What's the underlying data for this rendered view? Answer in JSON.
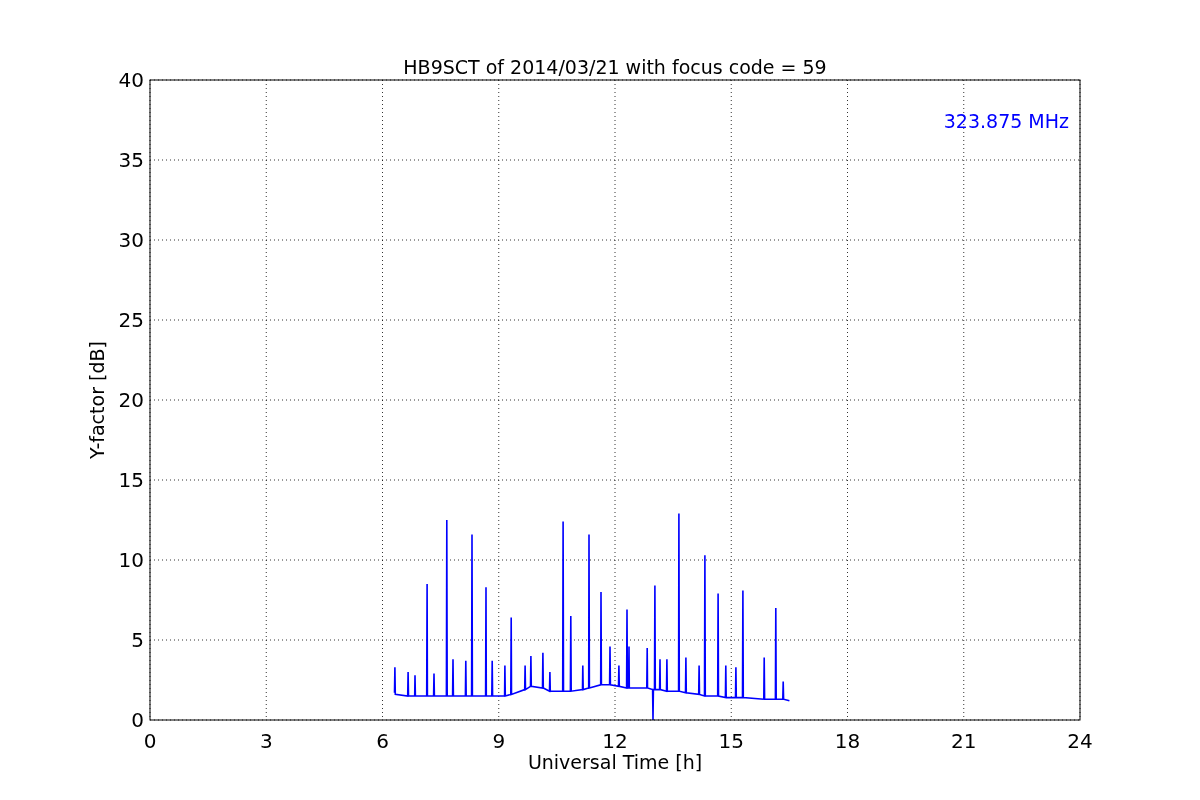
{
  "figure": {
    "chart_data": {
      "type": "line",
      "title": "HB9SCT of 2014/03/21 with focus code = 59",
      "xlabel": "Universal Time [h]",
      "ylabel": "Y-factor [dB]",
      "xlim": [
        0,
        24
      ],
      "ylim": [
        0,
        40
      ],
      "xticks": [
        0,
        3,
        6,
        9,
        12,
        15,
        18,
        21,
        24
      ],
      "yticks": [
        0,
        5,
        10,
        15,
        20,
        25,
        30,
        35,
        40
      ],
      "x": [
        6.31,
        6.32,
        6.33,
        6.65,
        6.66,
        6.67,
        6.83,
        6.84,
        6.85,
        7.14,
        7.15,
        7.16,
        7.32,
        7.33,
        7.34,
        7.65,
        7.66,
        7.67,
        7.81,
        7.82,
        7.83,
        8.14,
        8.15,
        8.16,
        8.3,
        8.31,
        8.32,
        8.66,
        8.67,
        8.68,
        8.82,
        8.83,
        8.84,
        9.15,
        9.16,
        9.17,
        9.31,
        9.32,
        9.33,
        9.67,
        9.68,
        9.69,
        9.82,
        9.83,
        9.84,
        10.13,
        10.14,
        10.15,
        10.31,
        10.32,
        10.33,
        10.65,
        10.66,
        10.67,
        10.85,
        10.86,
        10.87,
        11.16,
        11.17,
        11.18,
        11.32,
        11.33,
        11.34,
        11.63,
        11.64,
        11.65,
        11.86,
        11.87,
        11.88,
        12.09,
        12.1,
        12.11,
        12.3,
        12.31,
        12.32,
        12.35,
        12.36,
        12.37,
        12.82,
        12.83,
        12.84,
        12.97,
        12.98,
        12.99,
        13.02,
        13.03,
        13.04,
        13.15,
        13.16,
        13.17,
        13.33,
        13.34,
        13.35,
        13.64,
        13.65,
        13.66,
        13.82,
        13.83,
        13.84,
        14.16,
        14.17,
        14.18,
        14.31,
        14.32,
        14.33,
        14.65,
        14.66,
        14.67,
        14.85,
        14.86,
        14.87,
        15.11,
        15.12,
        15.13,
        15.29,
        15.3,
        15.31,
        15.84,
        15.85,
        15.86,
        16.14,
        16.15,
        16.16,
        16.33,
        16.34,
        16.35,
        16.5
      ],
      "series": [
        {
          "color": "#0000ff",
          "values": [
            1.7,
            3.3,
            1.6,
            1.5,
            3.0,
            1.5,
            1.5,
            2.8,
            1.5,
            1.5,
            8.5,
            1.5,
            1.5,
            2.9,
            1.5,
            1.5,
            12.5,
            1.5,
            1.5,
            3.8,
            1.5,
            1.5,
            3.7,
            1.5,
            1.5,
            11.6,
            1.5,
            1.5,
            8.3,
            1.5,
            1.5,
            3.7,
            1.5,
            1.5,
            3.4,
            1.5,
            1.6,
            6.4,
            1.6,
            1.9,
            3.4,
            1.9,
            2.1,
            4.0,
            2.1,
            2.0,
            4.2,
            2.0,
            1.8,
            3.0,
            1.8,
            1.8,
            12.4,
            1.8,
            1.8,
            6.5,
            1.8,
            1.9,
            3.4,
            1.9,
            2.0,
            11.6,
            2.0,
            2.2,
            8.0,
            2.2,
            2.2,
            4.6,
            2.2,
            2.1,
            3.4,
            2.1,
            2.0,
            6.9,
            2.0,
            2.0,
            4.6,
            2.0,
            2.0,
            4.5,
            2.0,
            1.9,
            0,
            1.9,
            1.9,
            8.4,
            1.9,
            1.9,
            3.8,
            1.9,
            1.8,
            3.8,
            1.8,
            1.8,
            12.9,
            1.8,
            1.7,
            3.9,
            1.7,
            1.6,
            3.4,
            1.6,
            1.5,
            10.3,
            1.5,
            1.5,
            7.9,
            1.5,
            1.4,
            3.4,
            1.4,
            1.4,
            3.3,
            1.4,
            1.4,
            8.1,
            1.4,
            1.3,
            3.9,
            1.3,
            1.3,
            7.0,
            1.3,
            1.3,
            2.4,
            1.3,
            1.2
          ]
        }
      ],
      "annotations": [
        {
          "text": "323.875 MHz"
        }
      ],
      "grid": true
    }
  }
}
